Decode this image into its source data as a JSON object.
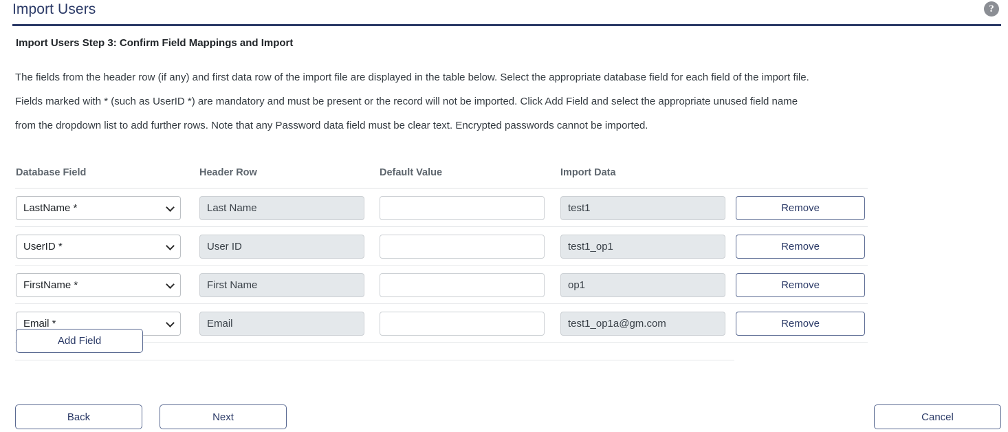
{
  "header": {
    "title": "Import Users",
    "help_icon": "help-circle-icon",
    "help_glyph": "?"
  },
  "step_heading": "Import Users Step 3: Confirm Field Mappings and Import",
  "intro_lines": [
    "The fields from the header row (if any) and first data row of the import file are displayed in the table below. Select the appropriate database field for each field of the import file.",
    "Fields marked with * (such as UserID *) are mandatory and must be present or the record will not be imported. Click Add Field and select the appropriate unused field name",
    "from the dropdown list to add further rows. Note that any Password data field must be clear text. Encrypted passwords cannot be imported."
  ],
  "table": {
    "columns": [
      "Database Field",
      "Header Row",
      "Default Value",
      "Import Data"
    ],
    "remove_label": "Remove",
    "rows": [
      {
        "database_field": "LastName *",
        "header_row": "Last Name",
        "default_value": "",
        "default_placeholder": "",
        "import_data": "test1",
        "remove_label": "Remove"
      },
      {
        "database_field": "UserID *",
        "header_row": "User ID",
        "default_value": "",
        "default_placeholder": "",
        "import_data": "test1_op1",
        "remove_label": "Remove"
      },
      {
        "database_field": "FirstName *",
        "header_row": "First Name",
        "default_value": "",
        "default_placeholder": "",
        "import_data": "op1",
        "remove_label": "Remove"
      },
      {
        "database_field": "Email *",
        "header_row": "Email",
        "default_value": "",
        "default_placeholder": "",
        "import_data": "test1_op1a@gm.com",
        "remove_label": "Remove"
      }
    ]
  },
  "add_field_label": "Add Field",
  "footer": {
    "back_label": "Back",
    "next_label": "Next",
    "cancel_label": "Cancel"
  },
  "colors": {
    "brand_navy": "#2b3a67",
    "button_border": "#5a6a92",
    "readonly_bg": "#e4e8eb",
    "column_header": "#5d656d",
    "divider": "#e6e8ea",
    "help_icon_bg": "#8b8e94"
  }
}
